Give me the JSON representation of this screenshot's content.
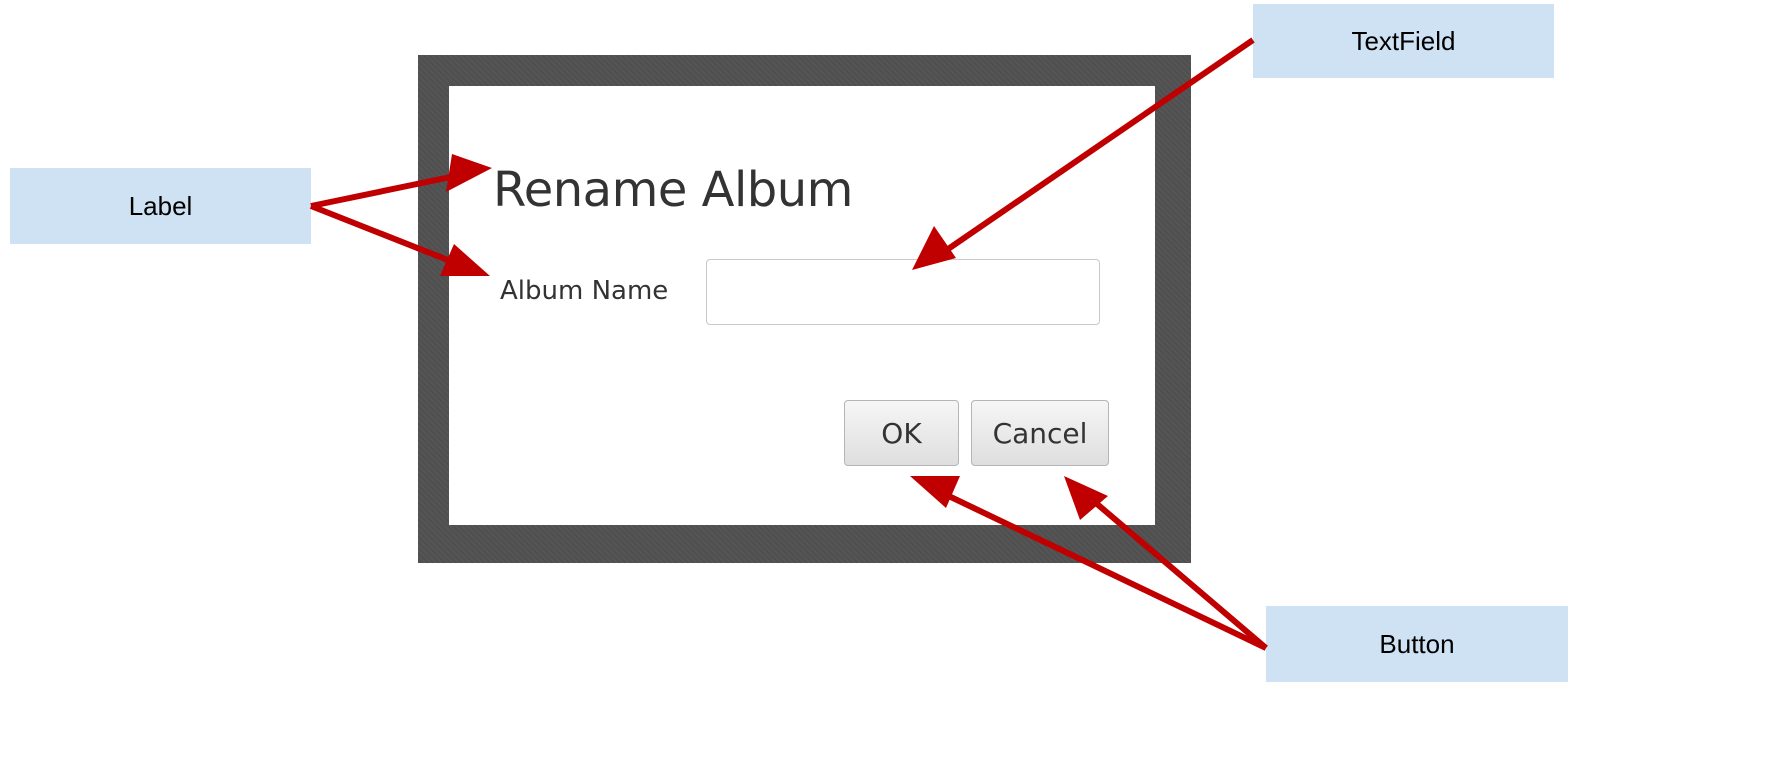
{
  "dialog": {
    "title": "Rename Album",
    "field_label": "Album Name",
    "text_field_value": "",
    "ok_label": "OK",
    "cancel_label": "Cancel"
  },
  "annotations": {
    "label": "Label",
    "textfield": "TextField",
    "button": "Button"
  },
  "colors": {
    "arrow": "#c00000",
    "callout_bg": "#cfe2f3",
    "frame": "#4f4f4f"
  }
}
